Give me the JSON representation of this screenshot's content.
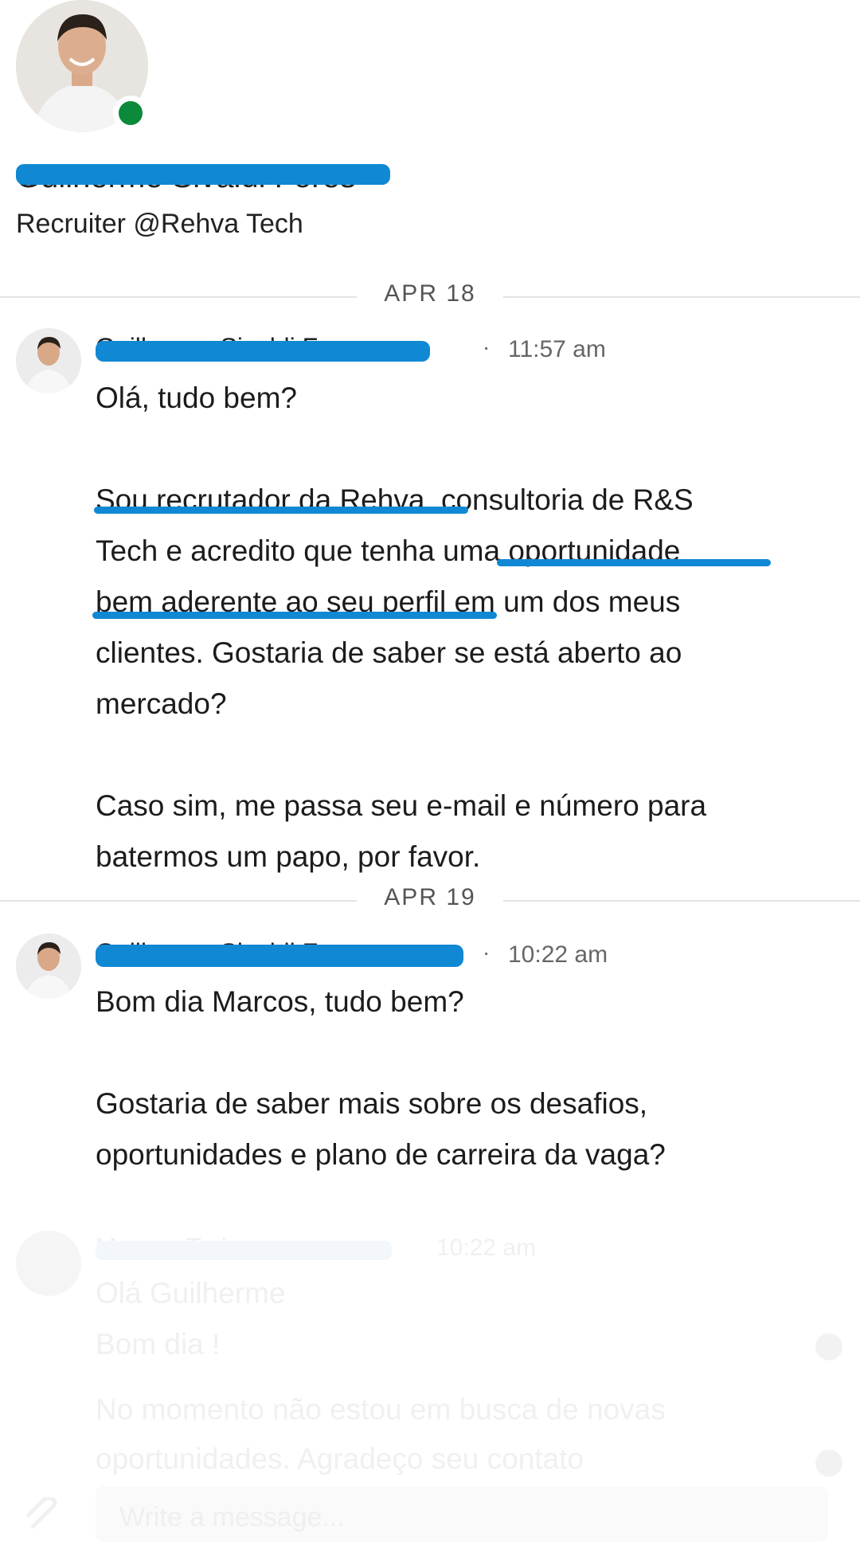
{
  "profile": {
    "name": "Guilherme Sivaldi Fores",
    "title": "Recruiter @Rehva Tech"
  },
  "dates": [
    "APR 18",
    "APR 19"
  ],
  "messages": [
    {
      "sender": "Guilherme Sivaldi Fores",
      "time": "11:57 am",
      "text": "Olá, tudo bem?\n\nSou recrutador da Rehva, consultoria de R&S\nTech e acredito que tenha uma oportunidade\nbem aderente ao seu perfil em um dos meus\nclientes. Gostaria de saber se está aberto ao\nmercado?\n\nCaso sim, me passa seu e-mail e número para\nbatermos um papo, por favor."
    },
    {
      "sender": "Guilherme Sivaldi Fores",
      "time": "10:22 am",
      "text": "Bom dia Marcos, tudo bem?\n\nGostaria de saber mais sobre os desafios,\noportunidades e plano de carreira da vaga?"
    },
    {
      "sender": "Marcos Tadeu",
      "time": "10:22 am",
      "line1": "Olá Guilherme",
      "line2": "Bom dia !",
      "line3": "No momento não estou em busca de novas",
      "line4": "oportunidades. Agradeço seu contato"
    }
  ],
  "composer": {
    "placeholder": "Write a message..."
  },
  "colors": {
    "redaction": "#1088d4",
    "online": "#0a8a3a"
  }
}
